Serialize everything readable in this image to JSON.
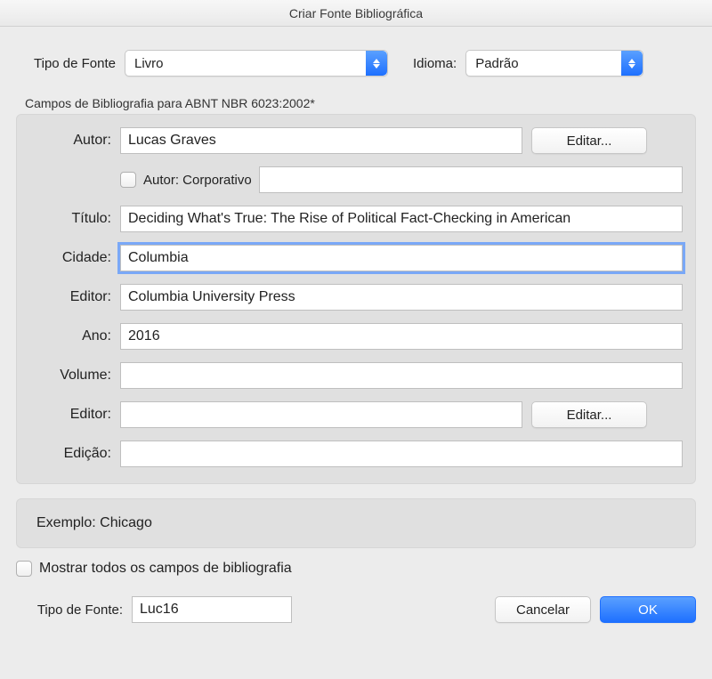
{
  "window_title": "Criar Fonte Bibliográfica",
  "top": {
    "source_type_label": "Tipo de Fonte",
    "source_type_value": "Livro",
    "language_label": "Idioma:",
    "language_value": "Padrão"
  },
  "panel_caption": "Campos de Bibliografia para ABNT NBR 6023:2002*",
  "fields": {
    "author_label": "Autor:",
    "author_value": "Lucas Graves",
    "edit_button": "Editar...",
    "corporate_label": "Autor: Corporativo",
    "corporate_value": "",
    "title_label": "Título:",
    "title_value": "Deciding What's True: The Rise of Political Fact-Checking in American",
    "city_label": "Cidade:",
    "city_value": "Columbia",
    "publisher_label": "Editor:",
    "publisher_value": "Columbia University Press",
    "year_label": "Ano:",
    "year_value": "2016",
    "volume_label": "Volume:",
    "volume_value": "",
    "editor2_label": "Editor:",
    "editor2_value": "",
    "edition_label": "Edição:",
    "edition_value": ""
  },
  "example_line": "Exemplo: Chicago",
  "show_all_label": "Mostrar todos os campos de bibliografia",
  "bottom": {
    "tag_label": "Tipo de Fonte:",
    "tag_value": "Luc16",
    "cancel": "Cancelar",
    "ok": "OK"
  }
}
